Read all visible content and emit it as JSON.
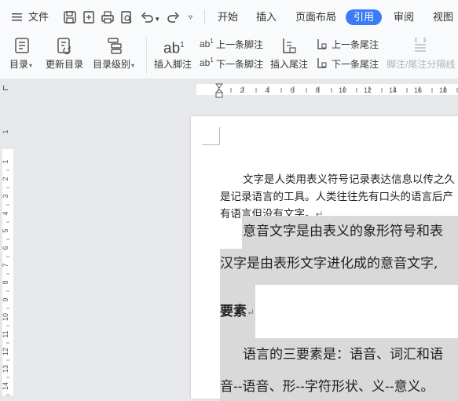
{
  "menubar": {
    "file_label": "文件",
    "tabs": [
      {
        "label": "开始"
      },
      {
        "label": "插入"
      },
      {
        "label": "页面布局"
      },
      {
        "label": "引用"
      },
      {
        "label": "审阅"
      },
      {
        "label": "视图"
      }
    ],
    "active_tab": "引用"
  },
  "ribbon": {
    "toc": "目录",
    "update_toc": "更新目录",
    "toc_level": "目录级别",
    "insert_footnote": "插入脚注",
    "prev_footnote": "上一条脚注",
    "next_footnote": "下一条脚注",
    "insert_endnote": "插入尾注",
    "prev_endnote": "上一条尾注",
    "next_endnote": "下一条尾注",
    "separator": "脚注/尾注分隔线"
  },
  "ruler": {
    "h_ticks": [
      "2",
      "4",
      "6",
      "8",
      "10",
      "12",
      "14",
      "16",
      "18"
    ],
    "v_ticks": [
      "1",
      "1",
      "2",
      "3",
      "4",
      "5",
      "6",
      "7",
      "8",
      "9",
      "10",
      "11",
      "12",
      "13",
      "14"
    ]
  },
  "document": {
    "para1_line1": "文字是人类用表义符号记录表达信息以传之久",
    "para1_line2": "是记录语言的工具。人类往往先有口头的语言后产",
    "para1_line3": "有语言但没有文字。",
    "para2_line1": "意音文字是由表义的象形符号和表",
    "para2_line2": "汉字是由表形文字进化成的意音文字,",
    "heading": "要素",
    "para3_line1": "语言的三要素是：语音、词汇和语",
    "para3_line2": "音--语音、形--字符形状、义--意义。"
  }
}
